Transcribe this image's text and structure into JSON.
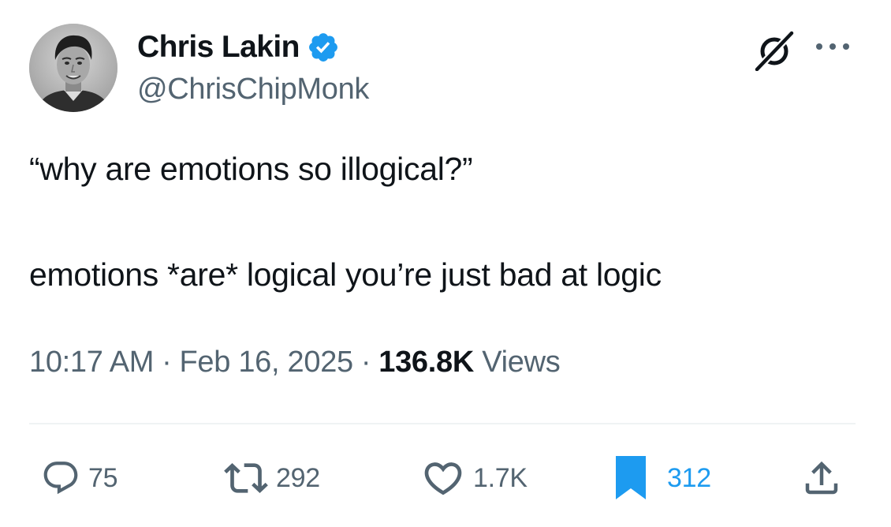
{
  "author": {
    "display_name": "Chris Lakin",
    "handle": "@ChrisChipMonk",
    "verified": true,
    "verified_color": "#1d9bf0",
    "avatar_icon": "profile-photo"
  },
  "header_actions": {
    "grok_icon": "grok-icon",
    "more_icon": "more-horizontal-icon"
  },
  "tweet": {
    "line1": "“why are emotions so illogical?”",
    "line2": "emotions *are* logical you’re just bad at logic"
  },
  "meta": {
    "time": "10:17 AM",
    "separator": "·",
    "date": "Feb 16, 2025",
    "views_count": "136.8K",
    "views_label": "Views"
  },
  "actions": {
    "replies": "75",
    "retweets": "292",
    "likes": "1.7K",
    "bookmarks": "312",
    "bookmarked": true,
    "accent_color": "#1d9bf0",
    "muted_color": "#536471"
  }
}
